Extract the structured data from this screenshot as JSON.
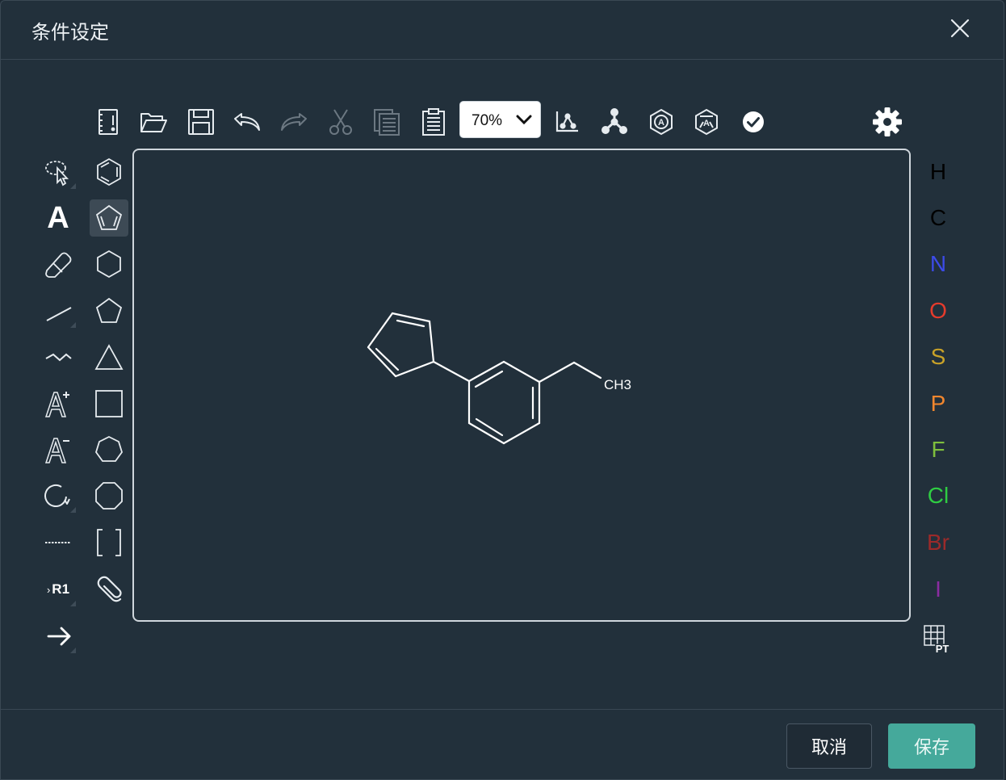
{
  "dialog": {
    "title": "条件设定",
    "cancel_label": "取消",
    "save_label": "保存"
  },
  "toolbar": {
    "zoom_value": "70%",
    "icons": [
      "template-icon",
      "open-folder-icon",
      "save-disk-icon",
      "undo-icon",
      "redo-icon",
      "cut-icon",
      "copy-icon",
      "paste-icon",
      "zoom-select",
      "layout-icon",
      "clean-up-icon",
      "aromatize-icon",
      "dearomatize-icon",
      "check-icon",
      "settings-gear-icon"
    ]
  },
  "canvas": {
    "molecule_label": "CH3"
  },
  "elements": [
    {
      "symbol": "H",
      "color": "#000000"
    },
    {
      "symbol": "C",
      "color": "#000000"
    },
    {
      "symbol": "N",
      "color": "#3c4be8"
    },
    {
      "symbol": "O",
      "color": "#e53b2c"
    },
    {
      "symbol": "S",
      "color": "#c9a228"
    },
    {
      "symbol": "P",
      "color": "#f0862e"
    },
    {
      "symbol": "F",
      "color": "#7fbf3d"
    },
    {
      "symbol": "Cl",
      "color": "#2fcc43"
    },
    {
      "symbol": "Br",
      "color": "#9c2a2a"
    },
    {
      "symbol": "I",
      "color": "#8a2ca0"
    }
  ],
  "periodic_table_label": "PT",
  "rgroup_label": "R1",
  "text_tool_label": "A"
}
